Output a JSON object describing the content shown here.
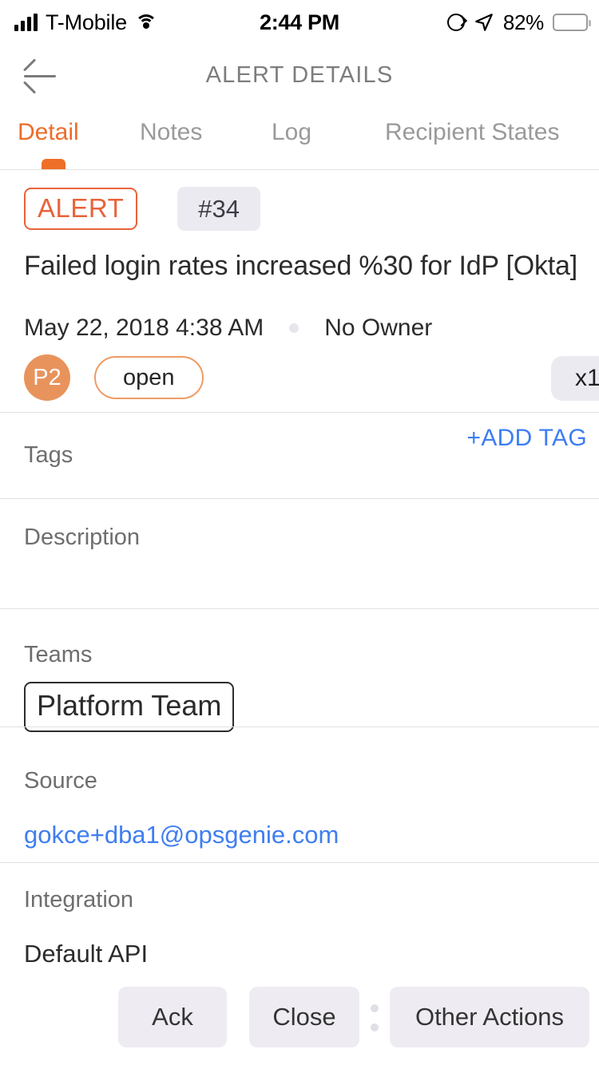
{
  "status_bar": {
    "carrier": "T-Mobile",
    "time": "2:44 PM",
    "battery_percent": "82%",
    "icons": [
      "signal-bars-icon",
      "wifi-icon",
      "rotation-lock-icon",
      "location-arrow-icon",
      "battery-icon"
    ]
  },
  "header": {
    "title": "ALERT DETAILS",
    "back_icon": "back-arrow-icon"
  },
  "tabs": [
    {
      "label": "Detail",
      "active": true
    },
    {
      "label": "Notes",
      "active": false
    },
    {
      "label": "Log",
      "active": false
    },
    {
      "label": "Recipient States",
      "active": false
    }
  ],
  "alert": {
    "type_badge": "ALERT",
    "id_chip": "#34",
    "title": "Failed login rates increased %30 for IdP [Okta]",
    "created_at": "May 22, 2018 4:38 AM",
    "owner": "No Owner",
    "priority": "P2",
    "state": "open",
    "count": "x1"
  },
  "sections": {
    "tags": {
      "label": "Tags",
      "action": "+ADD TAG",
      "value": ""
    },
    "description": {
      "label": "Description",
      "value": ""
    },
    "teams": {
      "label": "Teams",
      "value": "Platform Team"
    },
    "source": {
      "label": "Source",
      "value": "gokce+dba1@opsgenie.com"
    },
    "integration": {
      "label": "Integration",
      "value": "Default API"
    }
  },
  "actions": {
    "ack": "Ack",
    "close": "Close",
    "other": "Other Actions"
  },
  "colors": {
    "accent_orange": "#ed6c2a",
    "link_blue": "#3d7ef2",
    "chip_gray": "#eceaf1",
    "priority_orange": "#e8935c"
  }
}
